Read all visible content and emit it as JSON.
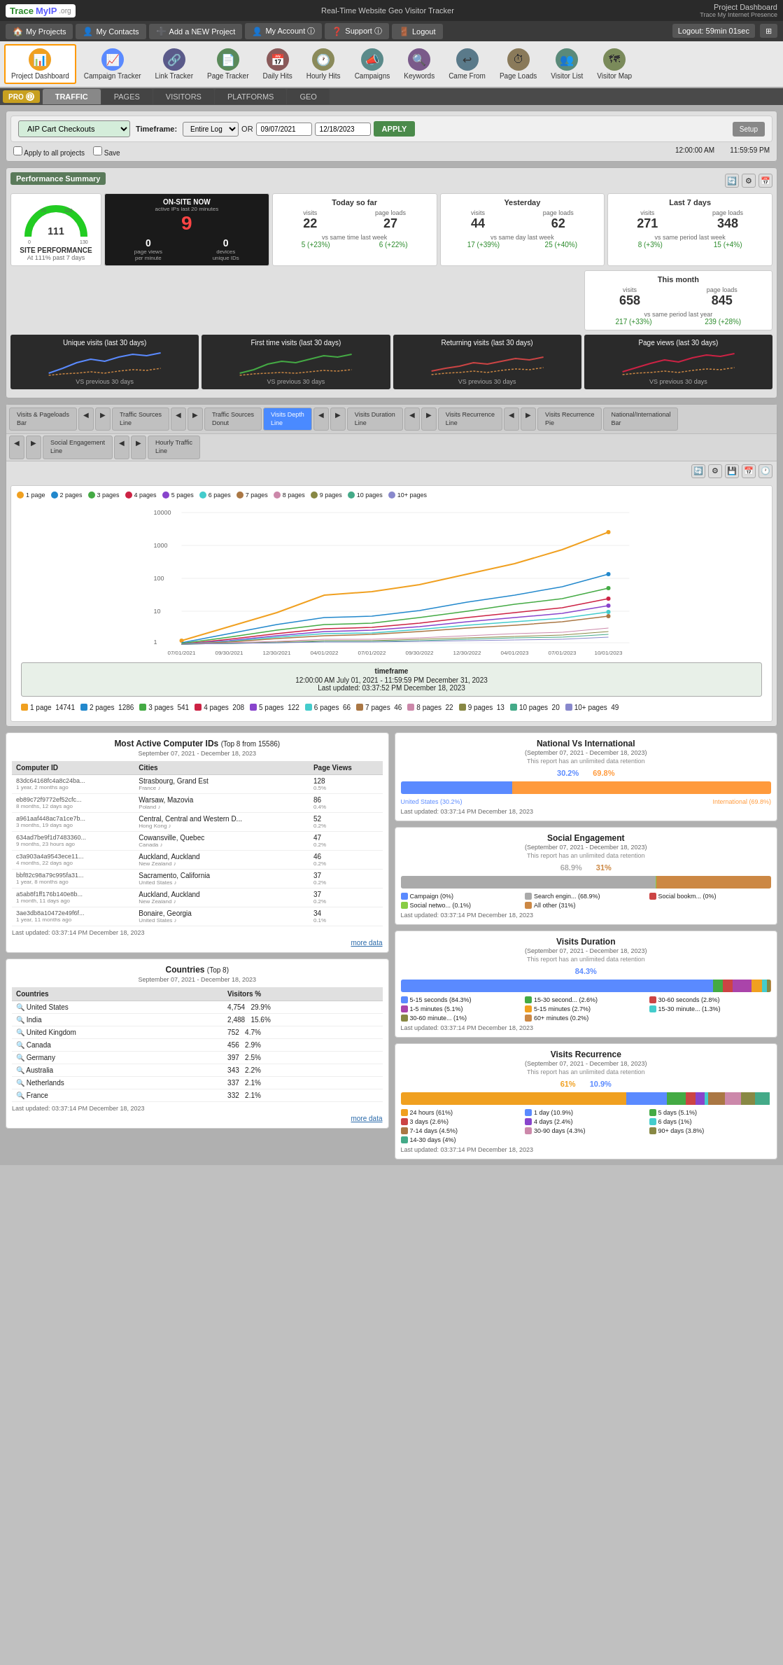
{
  "header": {
    "logo_text": "TraceMyIP",
    "logo_org": ".org",
    "center_text": "Real-Time Website Geo Visitor Tracker",
    "right_text": "Project Dashboard",
    "trace_text": "Trace My Internet Presence"
  },
  "nav": {
    "items": [
      {
        "label": "My Projects",
        "icon": "🏠"
      },
      {
        "label": "My Contacts",
        "icon": "👤"
      },
      {
        "label": "Add a NEW Project",
        "icon": "➕"
      },
      {
        "label": "My Account ⓘ",
        "icon": "👤"
      },
      {
        "label": "Support ⓘ",
        "icon": "❓"
      },
      {
        "label": "Logout",
        "icon": "🚪"
      }
    ],
    "session": "Logout: 59min 01sec"
  },
  "icon_toolbar": {
    "items": [
      {
        "label": "Project Dashboard",
        "icon": "📊",
        "active": true,
        "color": "#f90"
      },
      {
        "label": "Campaign Tracker",
        "icon": "📈",
        "active": false,
        "color": "#5a8aff"
      },
      {
        "label": "Link Tracker",
        "icon": "🔗",
        "active": false,
        "color": "#5a5a8a"
      },
      {
        "label": "Page Tracker",
        "icon": "📄",
        "active": false,
        "color": "#5a8a5a"
      },
      {
        "label": "Daily Hits",
        "icon": "📅",
        "active": false,
        "color": "#8a5a5a"
      },
      {
        "label": "Hourly Hits",
        "icon": "🕐",
        "active": false,
        "color": "#8a8a5a"
      },
      {
        "label": "Campaigns",
        "icon": "📣",
        "active": false,
        "color": "#5a8a8a"
      },
      {
        "label": "Keywords",
        "icon": "🔍",
        "active": false,
        "color": "#7a5a8a"
      },
      {
        "label": "Came From",
        "icon": "↩",
        "active": false,
        "color": "#5a7a8a"
      },
      {
        "label": "Page Loads",
        "icon": "⏱",
        "active": false,
        "color": "#8a7a5a"
      },
      {
        "label": "Visitor List",
        "icon": "👥",
        "active": false,
        "color": "#5a8a7a"
      },
      {
        "label": "Visitor Map",
        "icon": "🗺",
        "active": false,
        "color": "#7a8a5a"
      }
    ]
  },
  "tabs": {
    "items": [
      {
        "label": "TRAFFIC",
        "active": true
      },
      {
        "label": "PAGES",
        "active": false
      },
      {
        "label": "VISITORS",
        "active": false
      },
      {
        "label": "PLATFORMS",
        "active": false
      },
      {
        "label": "GEO",
        "active": false
      }
    ]
  },
  "timeframe": {
    "project_label": "AIP Cart Checkouts",
    "label": "Timeframe:",
    "range": "Entire Log",
    "or_text": "OR",
    "start_date": "09/07/2021",
    "end_date": "12/18/2023",
    "start_time": "12:00:00 AM",
    "end_time": "11:59:59 PM",
    "apply_label": "APPLY",
    "setup_label": "Setup",
    "check1": "Apply to all projects",
    "check2": "Save"
  },
  "performance": {
    "section_title": "Performance Summary",
    "site_performance": {
      "label": "SITE PERFORMANCE",
      "sub": "At 111% past 7 days",
      "gauge_value": 111
    },
    "on_site_now": {
      "title": "ON-SITE NOW",
      "subtitle": "active IPs last 20 minutes",
      "count": "9",
      "page_views_label": "page views",
      "page_views_value": "0",
      "devices_label": "devices",
      "devices_sub": "unique IDs",
      "devices_value": "0",
      "per_minute": "per minute"
    },
    "today": {
      "title": "Today so far",
      "visits": "22",
      "page_loads": "27",
      "vs_label": "vs same time last week",
      "vs_visits": "5",
      "vs_visits_pct": "(+23%)",
      "vs_loads": "6",
      "vs_loads_pct": "(+22%)"
    },
    "yesterday": {
      "title": "Yesterday",
      "visits": "44",
      "page_loads": "62",
      "vs_label": "vs same day last week",
      "vs_visits": "17",
      "vs_visits_pct": "(+39%)",
      "vs_loads": "25",
      "vs_loads_pct": "(+40%)"
    },
    "last7": {
      "title": "Last 7 days",
      "visits": "271",
      "page_loads": "348",
      "vs_label": "vs same period last week",
      "vs_visits": "8",
      "vs_visits_pct": "(+3%)",
      "vs_loads": "15",
      "vs_loads_pct": "(+4%)"
    },
    "thismonth": {
      "title": "This month",
      "visits": "658",
      "page_loads": "845",
      "vs_label": "vs same period last year",
      "vs_visits": "217",
      "vs_visits_pct": "(+33%)",
      "vs_loads": "239",
      "vs_loads_pct": "(+28%)"
    }
  },
  "mini_panels": [
    {
      "title": "Unique visits (last 30 days)",
      "vs": "VS previous 30 days"
    },
    {
      "title": "First time visits (last 30 days)",
      "vs": "VS previous 30 days"
    },
    {
      "title": "Returning visits (last 30 days)",
      "vs": "VS previous 30 days"
    },
    {
      "title": "Page views (last 30 days)",
      "vs": "VS previous 30 days"
    }
  ],
  "chart_tabs_row1": [
    {
      "label": "Visits & Pageloads\nBar",
      "active": false
    },
    {
      "label": "◀ ▶",
      "nav": true
    },
    {
      "label": "Traffic Sources\nLine",
      "active": false
    },
    {
      "label": "◀ ▶",
      "nav": true
    },
    {
      "label": "Traffic Sources\nDonut",
      "active": false
    },
    {
      "label": "Visits Depth\nLine",
      "active": true
    },
    {
      "label": "◀ ▶",
      "nav": true
    },
    {
      "label": "Visits Duration\nLine",
      "active": false
    },
    {
      "label": "◀ ▶",
      "nav": true
    },
    {
      "label": "Visits Recurrence\nLine",
      "active": false
    },
    {
      "label": "◀ ▶",
      "nav": true
    },
    {
      "label": "Visits Recurrence\nPie",
      "active": false
    },
    {
      "label": "National/International\nBar",
      "active": false
    }
  ],
  "chart_tabs_row2": [
    {
      "label": "◀ ▶",
      "nav": true
    },
    {
      "label": "Social Engagement\nLine",
      "active": false
    },
    {
      "label": "◀ ▶",
      "nav": true
    },
    {
      "label": "Hourly Traffic\nLine",
      "active": false
    }
  ],
  "visits_depth_chart": {
    "title": "Visits Depth Line",
    "timeframe_label": "timeframe",
    "timeframe_dates": "12:00:00 AM July 01, 2021 - 11:59:59 PM December 31, 2023",
    "last_updated": "Last updated: 03:37:52 PM December 18, 2023",
    "legend": [
      {
        "label": "1 page",
        "color": "#f0a020",
        "count": "14741"
      },
      {
        "label": "2 pages",
        "color": "#2288cc",
        "count": "1286"
      },
      {
        "label": "3 pages",
        "color": "#44aa44",
        "count": "541"
      },
      {
        "label": "4 pages",
        "color": "#cc2244",
        "count": "208"
      },
      {
        "label": "5 pages",
        "color": "#8844cc",
        "count": "122"
      },
      {
        "label": "6 pages",
        "color": "#44cccc",
        "count": "66"
      },
      {
        "label": "7 pages",
        "color": "#aa7744",
        "count": "46"
      },
      {
        "label": "8 pages",
        "color": "#cc88aa",
        "count": "22"
      },
      {
        "label": "9 pages",
        "color": "#888844",
        "count": "13"
      },
      {
        "label": "10 pages",
        "color": "#44aa88",
        "count": "20"
      },
      {
        "label": "10+ pages",
        "color": "#8888cc",
        "count": "49"
      }
    ],
    "x_labels": [
      "07/01/2021",
      "09/30/2021",
      "12/30/2021",
      "04/01/2022",
      "07/01/2022",
      "09/30/2022",
      "12/30/2022",
      "04/01/2023",
      "07/01/2023",
      "10/01/2023"
    ],
    "y_labels": [
      "10000",
      "1000",
      "100",
      "10",
      "1"
    ]
  },
  "most_active": {
    "title": "Most Active Computer IDs",
    "subtitle_top": "(Top 8 from 15586)",
    "subtitle_dates": "September 07, 2021 - December 18, 2023",
    "columns": [
      "Computer ID",
      "Cities",
      "Page Views"
    ],
    "rows": [
      {
        "id": "83dc64168fc4a8c24ba...",
        "age": "1 year, 2 months ago",
        "city": "Strasbourg, Grand Est",
        "country": "France",
        "pv": "128",
        "pct": "0.5%"
      },
      {
        "id": "eb89c72f9772ef52cfc...",
        "age": "8 months, 12 days ago",
        "city": "Warsaw, Mazovia",
        "country": "Poland",
        "pv": "86",
        "pct": "0.4%"
      },
      {
        "id": "a961aaf448ac7a1ce7b...",
        "age": "3 months, 19 days ago",
        "city": "Central, Central and Western D...",
        "country": "Hong Kong",
        "pv": "52",
        "pct": "0.2%"
      },
      {
        "id": "634ad7be9f1d7483360...",
        "age": "9 months, 23 hours ago",
        "city": "Cowansville, Quebec",
        "country": "Canada",
        "pv": "47",
        "pct": "0.2%"
      },
      {
        "id": "c3a903a4a9543ece11...",
        "age": "4 months, 22 days ago",
        "city": "Auckland, Auckland",
        "country": "New Zealand",
        "pv": "46",
        "pct": "0.2%"
      },
      {
        "id": "bbf82c98a79c995fa31...",
        "age": "1 year, 8 months ago",
        "city": "Sacramento, California",
        "country": "United States",
        "pv": "37",
        "pct": "0.2%"
      },
      {
        "id": "a5ab8f1ff176b140e8b...",
        "age": "1 month, 11 days ago",
        "city": "Auckland, Auckland",
        "country": "New Zealand",
        "pv": "37",
        "pct": "0.2%"
      },
      {
        "id": "3ae3db8a10472e49f6f...",
        "age": "1 year, 11 months ago",
        "city": "Bonaire, Georgia",
        "country": "United States",
        "pv": "34",
        "pct": "0.1%"
      }
    ],
    "last_updated": "Last updated: 03:37:14 PM December 18, 2023",
    "more_data": "more data"
  },
  "countries": {
    "title": "Countries",
    "subtitle_top": "(Top 8)",
    "subtitle_dates": "September 07, 2021 - December 18, 2023",
    "columns": [
      "Countries",
      "Visitors %"
    ],
    "rows": [
      {
        "name": "United States",
        "visitors": "4,754",
        "pct": "29.9%"
      },
      {
        "name": "India",
        "visitors": "2,488",
        "pct": "15.6%"
      },
      {
        "name": "United Kingdom",
        "visitors": "752",
        "pct": "4.7%"
      },
      {
        "name": "Canada",
        "visitors": "456",
        "pct": "2.9%"
      },
      {
        "name": "Germany",
        "visitors": "397",
        "pct": "2.5%"
      },
      {
        "name": "Australia",
        "visitors": "343",
        "pct": "2.2%"
      },
      {
        "name": "Netherlands",
        "visitors": "337",
        "pct": "2.1%"
      },
      {
        "name": "France",
        "visitors": "332",
        "pct": "2.1%"
      }
    ],
    "last_updated": "Last updated: 03:37:14 PM December 18, 2023",
    "more_data": "more data"
  },
  "national_vs_international": {
    "title": "National Vs International",
    "subtitle_dates": "(September 07, 2021 - December 18, 2023)",
    "note": "This report has an unlimited data retention",
    "us_pct": "30.2%",
    "int_pct": "69.8%",
    "us_label": "United States (30.2%)",
    "int_label": "International (69.8%)",
    "last_updated": "Last updated: 03:37:14 PM December 18, 2023"
  },
  "social_engagement": {
    "title": "Social Engagement",
    "subtitle_dates": "(September 07, 2021 - December 18, 2023)",
    "note": "This report has an unlimited data retention",
    "segments": [
      {
        "label": "Campaign (0%)",
        "color": "#5a8aff",
        "pct": 0
      },
      {
        "label": "Search engin... (68.9%)",
        "color": "#aaaaaa",
        "pct": 68.9
      },
      {
        "label": "Social bookm... (0%)",
        "color": "#cc4444",
        "pct": 0
      },
      {
        "label": "Social netwo... (0.1%)",
        "color": "#88cc44",
        "pct": 0.1
      },
      {
        "label": "All other (31%)",
        "color": "#cc8844",
        "pct": 31
      }
    ],
    "bar_pct1": "68.9%",
    "bar_pct2": "31%",
    "last_updated": "Last updated: 03:37:14 PM December 18, 2023"
  },
  "visits_duration": {
    "title": "Visits Duration",
    "subtitle_dates": "(September 07, 2021 - December 18, 2023)",
    "note": "This report has an unlimited data retention",
    "bar_pct": "84.3%",
    "segments": [
      {
        "label": "5-15 seconds (84.3%)",
        "color": "#5a8aff",
        "pct": 84.3
      },
      {
        "label": "15-30 second... (2.6%)",
        "color": "#44aa44",
        "pct": 2.6
      },
      {
        "label": "30-60 seconds (2.8%)",
        "color": "#cc4444",
        "pct": 2.8
      },
      {
        "label": "1-5 minutes (5.1%)",
        "color": "#aa44aa",
        "pct": 5.1
      },
      {
        "label": "5-15 minutes (2.7%)",
        "color": "#f0a020",
        "pct": 2.7
      },
      {
        "label": "15-30 minute... (1.3%)",
        "color": "#44cccc",
        "pct": 1.3
      },
      {
        "label": "30-60 minute... (1%)",
        "color": "#888844",
        "pct": 1
      },
      {
        "label": "60+ minutes (0.2%)",
        "color": "#cc8844",
        "pct": 0.2
      }
    ],
    "last_updated": "Last updated: 03:37:14 PM December 18, 2023"
  },
  "visits_recurrence": {
    "title": "Visits Recurrence",
    "subtitle_dates": "(September 07, 2021 - December 18, 2023)",
    "note": "This report has an unlimited data retention",
    "bar_pct1": "61%",
    "bar_pct2": "10.9%",
    "segments": [
      {
        "label": "24 hours (61%)",
        "color": "#f0a020",
        "pct": 61
      },
      {
        "label": "1 day (10.9%)",
        "color": "#5a8aff",
        "pct": 10.9
      },
      {
        "label": "5 days (5.1%)",
        "color": "#44aa44",
        "pct": 5.1
      },
      {
        "label": "3 days (2.6%)",
        "color": "#cc4444",
        "pct": 2.6
      },
      {
        "label": "4 days (2.4%)",
        "color": "#8844cc",
        "pct": 2.4
      },
      {
        "label": "6 days (1%)",
        "color": "#44cccc",
        "pct": 1
      },
      {
        "label": "7-14 days (4.5%)",
        "color": "#aa7744",
        "pct": 4.5
      },
      {
        "label": "30-90 days (4.3%)",
        "color": "#cc88aa",
        "pct": 4.3
      },
      {
        "label": "90+ days (3.8%)",
        "color": "#888844",
        "pct": 3.8
      },
      {
        "label": "14-30 days (4%)",
        "color": "#44aa88",
        "pct": 4
      },
      {
        "label": "30-90 days (4.3%)",
        "color": "#8888cc",
        "pct": 4.3
      }
    ],
    "last_updated": "Last updated: 03:37:14 PM December 18, 2023"
  }
}
